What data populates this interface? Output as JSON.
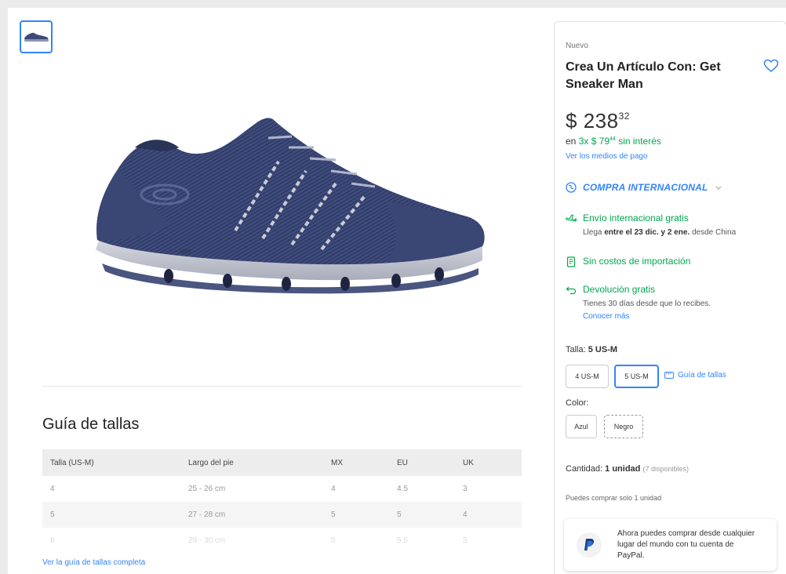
{
  "gallery": {
    "thumbnail_icon": "sneaker-thumbnail",
    "main_image_icon": "sneaker-photo"
  },
  "size_guide": {
    "title": "Guía de tallas",
    "columns": [
      "Talla (US-M)",
      "Largo del pie",
      "MX",
      "EU",
      "UK"
    ],
    "rows": [
      [
        "4",
        "25 - 26 cm",
        "4",
        "4.5",
        "3"
      ],
      [
        "5",
        "27 - 28 cm",
        "5",
        "5",
        "4"
      ],
      [
        "6",
        "29 - 30 cm",
        "5",
        "5.5",
        "5"
      ]
    ],
    "full_link": "Ver la guía de tallas completa"
  },
  "product": {
    "condition": "Nuevo",
    "title": "Crea Un Artículo Con: Get Sneaker Man",
    "price_currency": "$",
    "price_whole": "238",
    "price_cents": "32",
    "installments_prefix": "en ",
    "installments_main": "3x $ 79",
    "installments_cents": "44",
    "installments_suffix": " sin interés",
    "payment_link": "Ver los medios de pago"
  },
  "international": {
    "label": "COMPRA INTERNACIONAL"
  },
  "benefits": {
    "shipping_title": "Envío internacional gratis",
    "shipping_pre": "Llega ",
    "shipping_bold": "entre el 23 dic. y 2 ene.",
    "shipping_post": " desde China",
    "import_title": "Sin costos de importación",
    "return_title": "Devolución gratis",
    "return_sub": "Tienes 30 días desde que lo recibes.",
    "return_link": "Conocer más"
  },
  "size": {
    "label": "Talla: ",
    "selected": "5 US-M",
    "options": [
      "4 US-M",
      "5 US-M"
    ],
    "guide_link": "Guía de tallas"
  },
  "color": {
    "label": "Color:",
    "options": [
      "Azul",
      "Negro"
    ]
  },
  "quantity": {
    "label": "Cantidad: ",
    "value": "1 unidad",
    "available": "(7 disponibles)",
    "limit_note": "Puedes comprar solo 1 unidad"
  },
  "paypal": {
    "text": "Ahora puedes comprar desde cualquier lugar del mundo con tu cuenta de PayPal."
  },
  "colors": {
    "accent": "#3483fa",
    "green": "#00a650",
    "shoe": "#3d4a78"
  }
}
